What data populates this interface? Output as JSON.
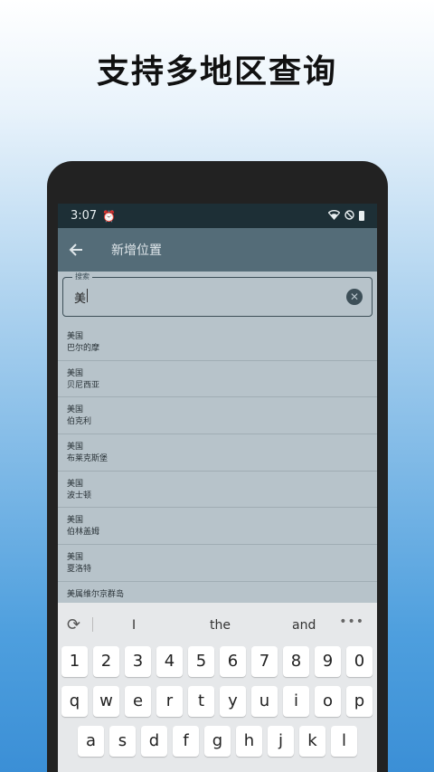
{
  "headline": "支持多地区查询",
  "status": {
    "time": "3:07",
    "alarm_icon": "alarm-icon",
    "wifi_icon": "wifi-icon",
    "dnd_icon": "dnd-icon",
    "battery_icon": "battery-icon"
  },
  "appbar": {
    "title": "新增位置"
  },
  "search": {
    "label": "搜索",
    "value": "美"
  },
  "results": [
    {
      "country": "美国",
      "city": "巴尔的摩"
    },
    {
      "country": "美国",
      "city": "贝尼西亚"
    },
    {
      "country": "美国",
      "city": "伯克利"
    },
    {
      "country": "美国",
      "city": "布莱克斯堡"
    },
    {
      "country": "美国",
      "city": "波士顿"
    },
    {
      "country": "美国",
      "city": "伯林盖姆"
    },
    {
      "country": "美国",
      "city": "夏洛特"
    },
    {
      "country": "美属维尔京群岛",
      "city": ""
    }
  ],
  "keyboard": {
    "suggestions": [
      "I",
      "the",
      "and"
    ],
    "row1": [
      "1",
      "2",
      "3",
      "4",
      "5",
      "6",
      "7",
      "8",
      "9",
      "0"
    ],
    "row2": [
      "q",
      "w",
      "e",
      "r",
      "t",
      "y",
      "u",
      "i",
      "o",
      "p"
    ],
    "row3": [
      "a",
      "s",
      "d",
      "f",
      "g",
      "h",
      "j",
      "k",
      "l"
    ]
  },
  "colors": {
    "statusbar": "#1d2f36",
    "appbar": "#546c78",
    "list_bg": "#b7c3ca",
    "keyboard_bg": "#e6e8ea"
  }
}
